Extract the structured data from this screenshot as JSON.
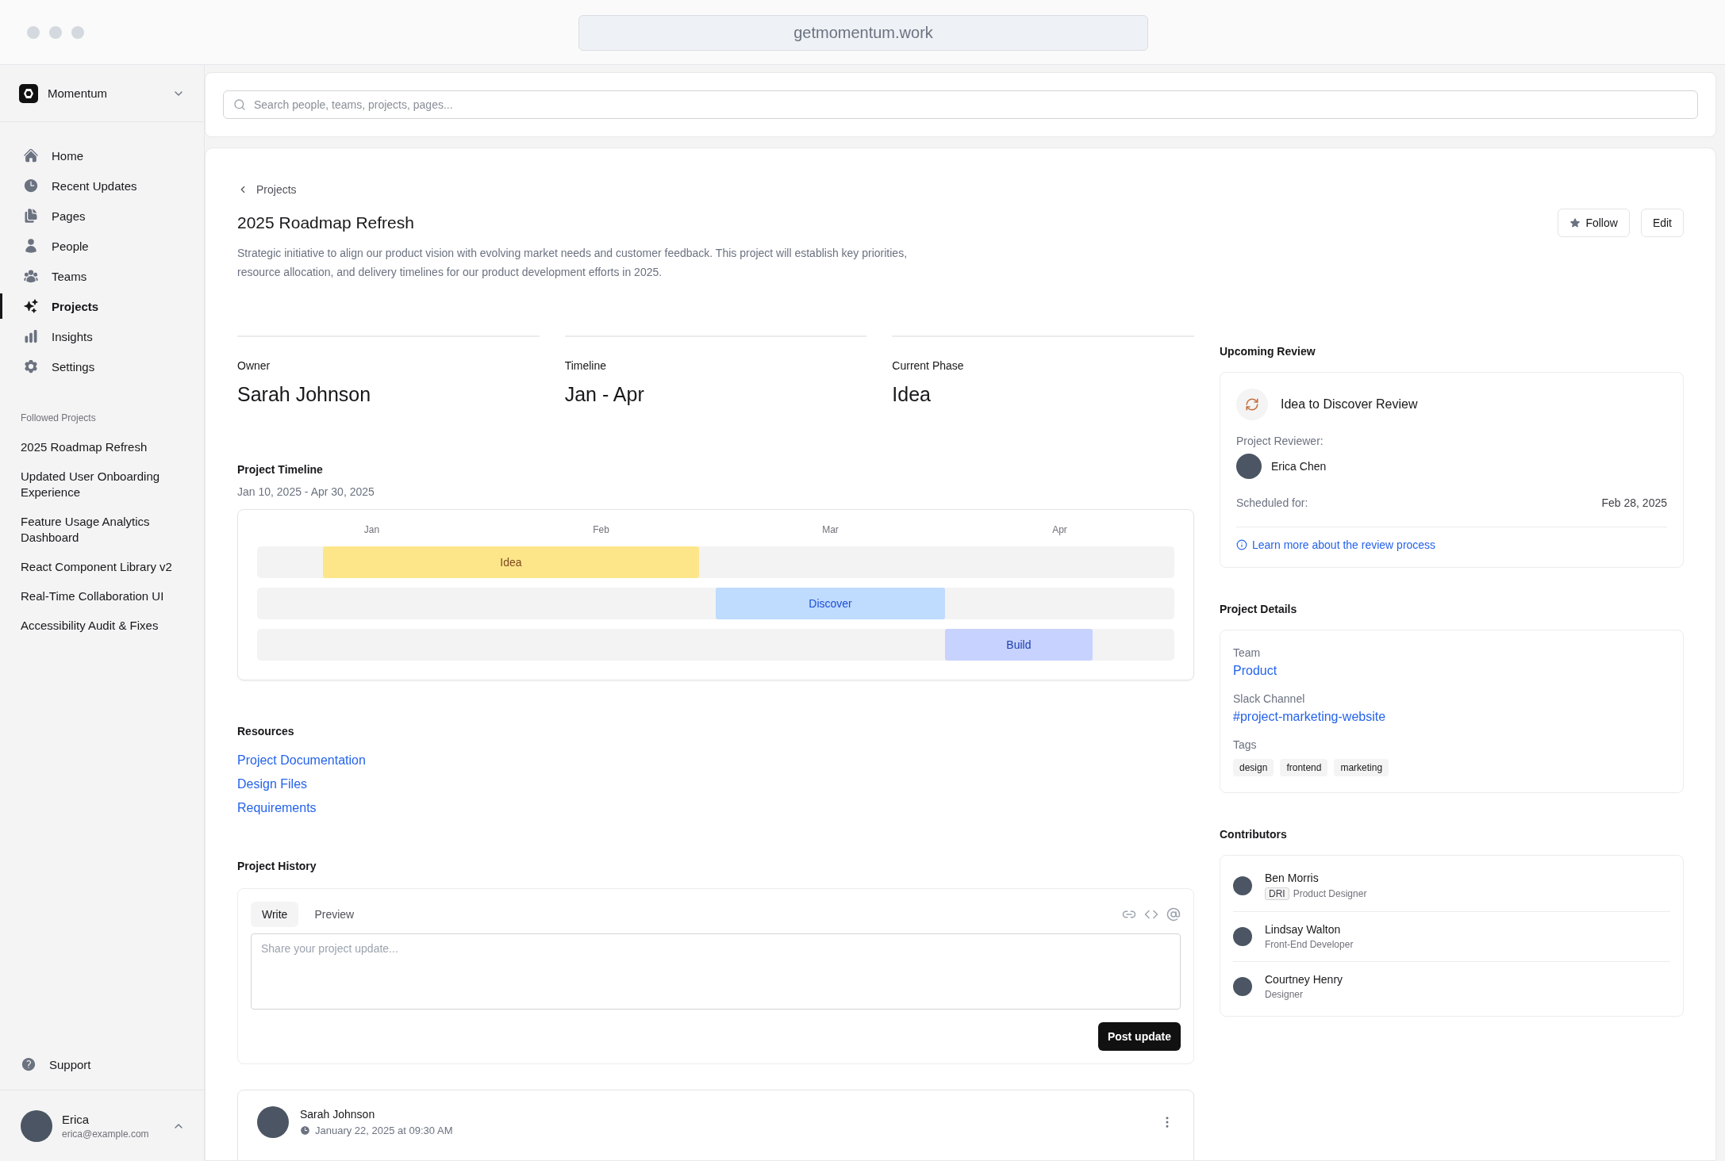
{
  "browser": {
    "url": "getmomentum.work"
  },
  "sidebar": {
    "workspace": "Momentum",
    "items": [
      {
        "label": "Home",
        "selected": false
      },
      {
        "label": "Recent Updates",
        "selected": false
      },
      {
        "label": "Pages",
        "selected": false
      },
      {
        "label": "People",
        "selected": false
      },
      {
        "label": "Teams",
        "selected": false
      },
      {
        "label": "Projects",
        "selected": true
      },
      {
        "label": "Insights",
        "selected": false
      },
      {
        "label": "Settings",
        "selected": false
      }
    ],
    "followed_title": "Followed Projects",
    "followed": [
      "2025 Roadmap Refresh",
      "Updated User Onboarding Experience",
      "Feature Usage Analytics Dashboard",
      "React Component Library v2",
      "Real-Time Collaboration UI",
      "Accessibility Audit & Fixes"
    ],
    "support": "Support",
    "user": {
      "name": "Erica",
      "email": "erica@example.com"
    }
  },
  "search": {
    "placeholder": "Search people, teams, projects, pages..."
  },
  "project": {
    "breadcrumb": "Projects",
    "title": "2025 Roadmap Refresh",
    "description": "Strategic initiative to align our product vision with evolving market needs and customer feedback. This project will establish key priorities, resource allocation, and delivery timelines for our product development efforts in 2025.",
    "actions": {
      "follow": "Follow",
      "edit": "Edit"
    },
    "stats": [
      {
        "label": "Owner",
        "value": "Sarah Johnson"
      },
      {
        "label": "Timeline",
        "value": "Jan - Apr"
      },
      {
        "label": "Current Phase",
        "value": "Idea"
      }
    ],
    "timeline": {
      "title": "Project Timeline",
      "dates": "Jan 10, 2025 - Apr 30, 2025",
      "months": [
        "Jan",
        "Feb",
        "Mar",
        "Apr"
      ],
      "phases": [
        {
          "label": "Idea",
          "color": "#fde68a"
        },
        {
          "label": "Discover",
          "color": "#bfdbfe"
        },
        {
          "label": "Build",
          "color": "#c7d2fe"
        }
      ]
    },
    "resources": {
      "title": "Resources",
      "links": [
        "Project Documentation",
        "Design Files",
        "Requirements"
      ]
    },
    "history": {
      "title": "Project History",
      "tabs": [
        {
          "label": "Write",
          "selected": true
        },
        {
          "label": "Preview",
          "selected": false
        }
      ],
      "placeholder": "Share your project update...",
      "submit": "Post update",
      "posts": [
        {
          "author": "Sarah Johnson",
          "time": "January 22, 2025 at 09:30 AM"
        }
      ]
    }
  },
  "review": {
    "title": "Upcoming Review",
    "name": "Idea to Discover Review",
    "reviewer_label": "Project Reviewer:",
    "reviewer": "Erica Chen",
    "scheduled_label": "Scheduled for:",
    "scheduled": "Feb 28, 2025",
    "link": "Learn more about the review process"
  },
  "details": {
    "title": "Project Details",
    "team_label": "Team",
    "team": "Product",
    "slack_label": "Slack Channel",
    "slack": "#project-marketing-website",
    "tags_label": "Tags",
    "tags": [
      "design",
      "frontend",
      "marketing"
    ]
  },
  "contributors": {
    "title": "Contributors",
    "people": [
      {
        "name": "Ben Morris",
        "badge": "DRI",
        "role": "Product Designer"
      },
      {
        "name": "Lindsay Walton",
        "role": "Front-End Developer"
      },
      {
        "name": "Courtney Henry",
        "role": "Designer"
      }
    ]
  }
}
